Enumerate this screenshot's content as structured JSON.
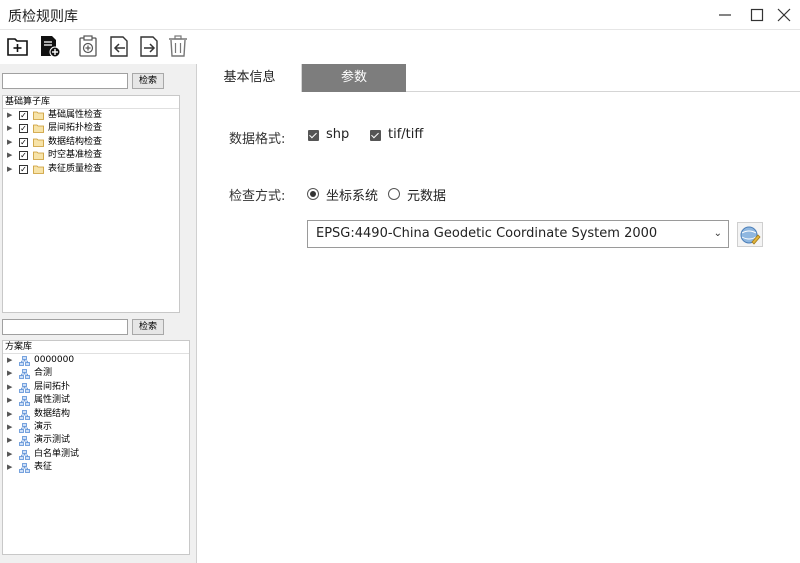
{
  "window": {
    "title": "质检规则库"
  },
  "toolbar": {
    "buttons": [
      "new-folder-icon",
      "new-file-icon",
      "add-rule-icon",
      "import-icon",
      "export-icon",
      "delete-icon"
    ]
  },
  "left": {
    "search1": {
      "value": "",
      "button": "检索"
    },
    "tree1": {
      "header": "基础算子库",
      "items": [
        "基础属性检查",
        "层间拓扑检查",
        "数据结构检查",
        "时空基准检查",
        "表征质量检查"
      ]
    },
    "search2": {
      "value": "",
      "button": "检索"
    },
    "tree2": {
      "header": "方案库",
      "items": [
        "0000000",
        "合测",
        "层间拓扑",
        "属性测试",
        "数据结构",
        "演示",
        "演示测试",
        "白名单测试",
        "表征"
      ]
    }
  },
  "tabs": [
    "基本信息",
    "参数"
  ],
  "params": {
    "format_label": "数据格式:",
    "format_options": [
      "shp",
      "tif/tiff"
    ],
    "method_label": "检查方式:",
    "method_options": [
      "坐标系统",
      "元数据"
    ],
    "crs_value": "EPSG:4490-China Geodetic Coordinate System 2000"
  },
  "colors": {
    "active_tab": "#7d7d7d",
    "folder": "#e8b84a",
    "node": "#5a8fd6"
  }
}
